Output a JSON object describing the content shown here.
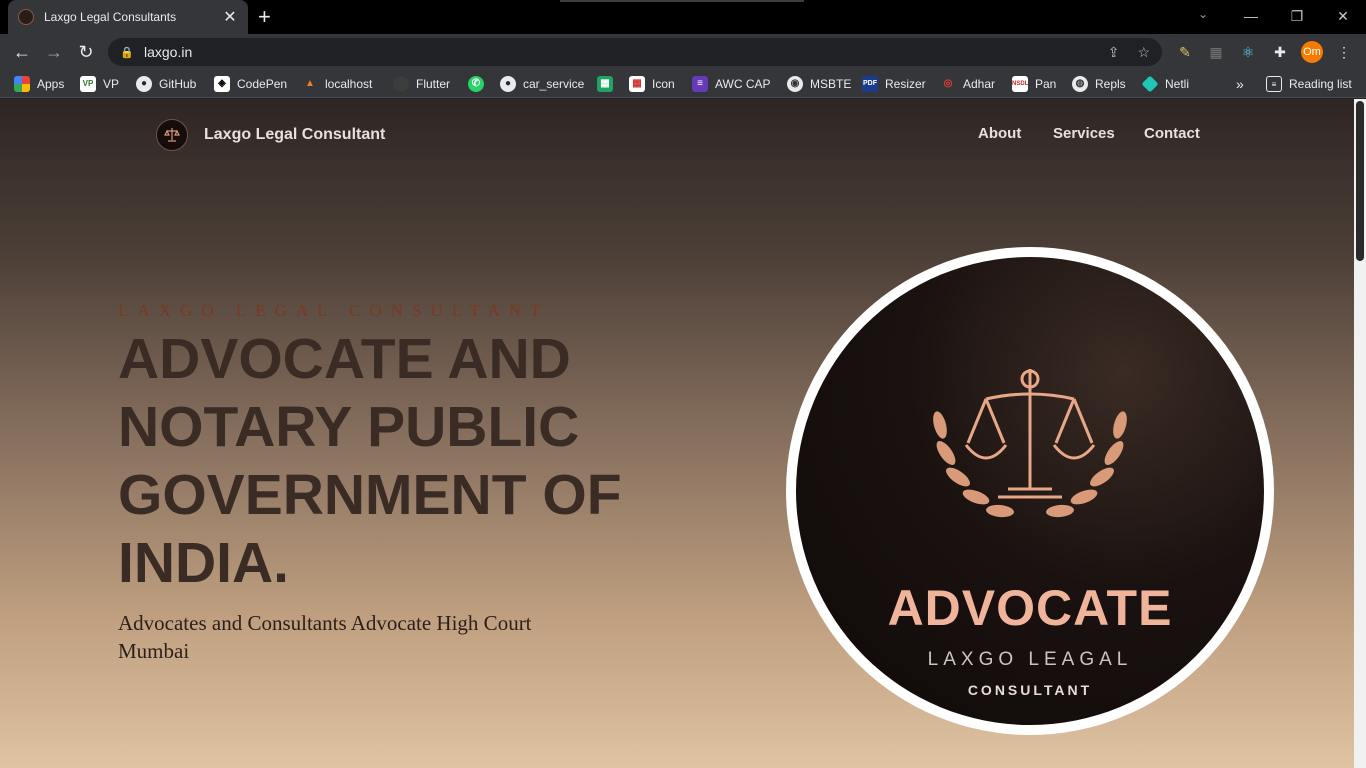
{
  "browser": {
    "tab_title": "Laxgo Legal Consultants",
    "url": "laxgo.in",
    "profile_initials": "Om"
  },
  "bookmarks": [
    {
      "label": "Apps",
      "icon": "apps-grid-icon"
    },
    {
      "label": "VP",
      "icon": "vp-icon"
    },
    {
      "label": "GitHub",
      "icon": "github-icon"
    },
    {
      "label": "CodePen",
      "icon": "codepen-icon"
    },
    {
      "label": "localhost",
      "icon": "localhost-icon"
    },
    {
      "label": "Flutter",
      "icon": "github-icon"
    },
    {
      "label": "",
      "icon": "whatsapp-icon"
    },
    {
      "label": "car_service",
      "icon": "github-icon"
    },
    {
      "label": "",
      "icon": "green-grid-icon"
    },
    {
      "label": "Icon",
      "icon": "red-grid-icon"
    },
    {
      "label": "AWC CAP",
      "icon": "list-icon"
    },
    {
      "label": "MSBTE",
      "icon": "msbte-icon"
    },
    {
      "label": "Resizer",
      "icon": "resizer-icon"
    },
    {
      "label": "Adhar",
      "icon": "aadhaar-icon"
    },
    {
      "label": "Pan",
      "icon": "pan-icon"
    },
    {
      "label": "Repls",
      "icon": "replit-icon"
    },
    {
      "label": "Netli",
      "icon": "netlify-icon"
    }
  ],
  "reading_list": "Reading list",
  "site": {
    "brand_name": "Laxgo Legal Consultant",
    "nav": [
      "About",
      "Services",
      "Contact"
    ],
    "eyebrow": "LAXGO LEGAL CONSULTANT",
    "headline": "ADVOCATE AND NOTARY PUBLIC GOVERNMENT OF INDIA.",
    "subline": "Advocates and Consultants Advocate High Court Mumbai",
    "logo_image": {
      "title": "ADVOCATE",
      "line1": "LAXGO LEAGAL",
      "line2": "CONSULTANT"
    }
  },
  "colors": {
    "accent": "#f0b49a",
    "eyebrow": "#7a3a1f",
    "headline": "#3a2b25"
  }
}
